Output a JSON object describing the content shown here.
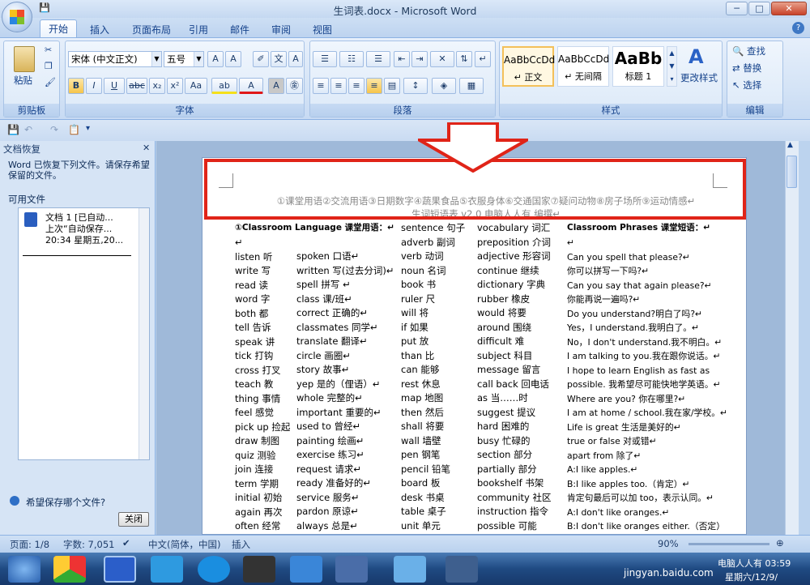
{
  "window": {
    "title": "生词表.docx - Microsoft Word",
    "buttons": [
      "─",
      "□",
      "✕"
    ]
  },
  "tabs": [
    "开始",
    "插入",
    "页面布局",
    "引用",
    "邮件",
    "审阅",
    "视图"
  ],
  "ribbon": {
    "clipboard": {
      "paste": "粘贴",
      "label": "剪贴板"
    },
    "font": {
      "name": "宋体 (中文正文)",
      "size": "五号",
      "label": "字体",
      "buttons": [
        "B",
        "I",
        "U",
        "abc",
        "x₂",
        "x²",
        "Aa",
        "ab",
        "A",
        "A",
        "㊎"
      ]
    },
    "paragraph": {
      "label": "段落"
    },
    "styles": {
      "items": [
        {
          "preview": "AaBbCcDd",
          "name": "↵ 正文"
        },
        {
          "preview": "AaBbCcDd",
          "name": "↵ 无间隔"
        },
        {
          "preview": "AaBb",
          "name": "标题 1"
        }
      ],
      "change": "更改样式",
      "label": "样式"
    },
    "editing": {
      "find": "查找",
      "replace": "替换",
      "select": "选择",
      "label": "编辑"
    }
  },
  "recovery": {
    "title": "文档恢复",
    "close_x": "✕",
    "desc": "Word 已恢复下列文件。请保存希望保留的文件。",
    "available": "可用文件",
    "file_line1": "文档 1  [已自动...",
    "file_line2": "上次“自动保存...",
    "file_line3": "20:34 星期五,20...",
    "which": "希望保存哪个文件?",
    "close": "关闭"
  },
  "document": {
    "header1": "①课堂用语②交流用语③日期数字④蔬果食品⑤衣服身体⑥交通国家⑦疑问动物⑧房子场所⑨运动情感↵",
    "header2": "生词短语表 v2.0 电脑人人有  编撰↵",
    "col1_head": "①Classroom Language 课堂用语：↵",
    "col1": [
      "↵",
      "listen 听",
      "write 写",
      "read 读",
      "word 字",
      "both 都",
      "tell 告诉",
      "speak 讲",
      "tick 打钩",
      "cross 打叉",
      "teach 教",
      "thing 事情",
      "feel 感觉",
      "pick up 捡起",
      "draw 制图",
      "quiz 测验",
      "join 连接",
      "term 学期",
      "initial 初始",
      "again 再次",
      "often 经常"
    ],
    "col2": [
      "spoken 口语↵",
      "written 写(过去分词)↵",
      "spell 拼写 ↵",
      "class 课/班↵",
      "correct 正确的↵",
      "classmates 同学↵",
      "translate 翻译↵",
      "circle 画圈↵",
      "story 故事↵",
      "yep 是的（俚语）↵",
      "whole 完整的↵",
      "important 重要的↵",
      "used to 曾经↵",
      "painting 绘画↵",
      "exercise  练习↵",
      "request 请求↵",
      "ready 准备好的↵",
      "service 服务↵",
      "pardon 原谅↵",
      "always 总是↵"
    ],
    "col3": [
      "sentence 句子",
      "adverb 副词",
      "verb 动词",
      "noun 名词",
      "book 书",
      "ruler 尺",
      "will 将",
      "if 如果",
      "put 放",
      "than 比",
      "can 能够",
      "rest 休息",
      "map 地图",
      "then 然后",
      "shall 将要",
      "wall 墙壁",
      "pen 钢笔",
      "pencil 铅笔",
      "board 板",
      "desk 书桌",
      "table 桌子",
      "unit 单元"
    ],
    "col4": [
      "vocabulary 词汇",
      "preposition 介词",
      "adjective 形容词",
      "continue 继续",
      "dictionary 字典",
      "rubber 橡皮",
      "would 将要",
      "around 围绕",
      "difficult 难",
      "subject 科目",
      "message 留言",
      "call back 回电话",
      "as 当……时",
      "suggest 提议",
      "hard 困难的",
      "busy 忙碌的",
      "section 部分",
      "partially 部分",
      "bookshelf 书架",
      "community 社区",
      "instruction 指令",
      "possible 可能"
    ],
    "col5_head": "Classroom Phrases 课堂短语：↵",
    "col5": [
      "↵",
      "Can you spell that please?↵",
      "你可以拼写一下吗?↵",
      "Can you say that again please?↵",
      "你能再说一遍吗?↵",
      "Do you understand?明白了吗?↵",
      "Yes，I understand.我明白了。↵",
      "No，I don't understand.我不明白。↵",
      "I am talking to you.我在跟你说话。↵",
      "I hope to learn English as fast as",
      "possible. 我希望尽可能快地学英语。↵",
      "Where are you? 你在哪里?↵",
      "I am at home / school.我在家/学校。↵",
      "Life is great 生活是美好的↵",
      "true or false 对或错↵",
      "apart from 除了↵",
      "A:I like apples.↵",
      "B:I like apples too.（肯定）↵",
      "肯定句最后可以加 too，表示认同。↵",
      "A:I don't like oranges.↵",
      "B:I don't like oranges either.（否定）"
    ]
  },
  "status": {
    "page": "页面: 1/8",
    "words": "字数: 7,051",
    "lang": "中文(简体，中国)",
    "mode": "插入",
    "zoom": "90%"
  },
  "taskbar": {
    "tray1": "电脑人人有 03:59",
    "tray2": "星期六/12/9/",
    "watermark": "jingyan.baidu.com"
  }
}
